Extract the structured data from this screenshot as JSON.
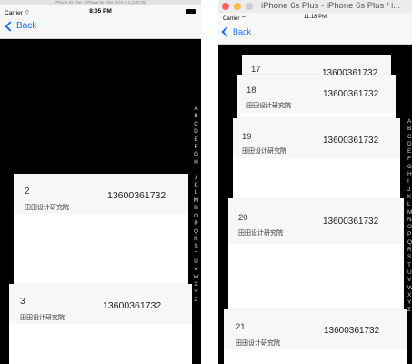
{
  "left": {
    "window_title": "iPhone 6s Plus - iPhone 6s Plus / iOS 9.2 (13C75)",
    "carrier": "Carrier",
    "time": "8:05 PM",
    "back_label": "Back",
    "index_letters": [
      "A",
      "B",
      "C",
      "D",
      "E",
      "F",
      "G",
      "H",
      "I",
      "J",
      "K",
      "L",
      "M",
      "N",
      "O",
      "P",
      "Q",
      "R",
      "S",
      "T",
      "U",
      "V",
      "W",
      "X",
      "Y",
      "Z"
    ],
    "cards": [
      {
        "num": "2",
        "phone": "13600361732",
        "org": "田田设计研究院"
      },
      {
        "num": "3",
        "phone": "13600361732",
        "org": "田田设计研究院"
      }
    ]
  },
  "right": {
    "window_title": "iPhone 6s Plus - iPhone 6s Plus / i...",
    "carrier": "Carrier",
    "time": "11:18 PM",
    "back_label": "Back",
    "index_letters": [
      "A",
      "B",
      "C",
      "D",
      "E",
      "F",
      "G",
      "H",
      "I",
      "J",
      "K",
      "L",
      "M",
      "N",
      "O",
      "P",
      "Q",
      "R",
      "S",
      "T",
      "U",
      "V",
      "W",
      "X",
      "Y",
      "Z"
    ],
    "cards": [
      {
        "num": "17",
        "phone": "13600361732"
      },
      {
        "num": "18",
        "phone": "13600361732",
        "org": "田田设计研究院"
      },
      {
        "num": "19",
        "phone": "13600361732",
        "org": "田田设计研究院"
      },
      {
        "num": "20",
        "phone": "13600361732",
        "org": "田田设计研究院"
      },
      {
        "num": "21",
        "phone": "13600361732",
        "org": "田田设计研究院"
      }
    ]
  },
  "colors": {
    "accent": "#1a74f0",
    "background": "#000000",
    "nav": "#f7f7f7"
  }
}
